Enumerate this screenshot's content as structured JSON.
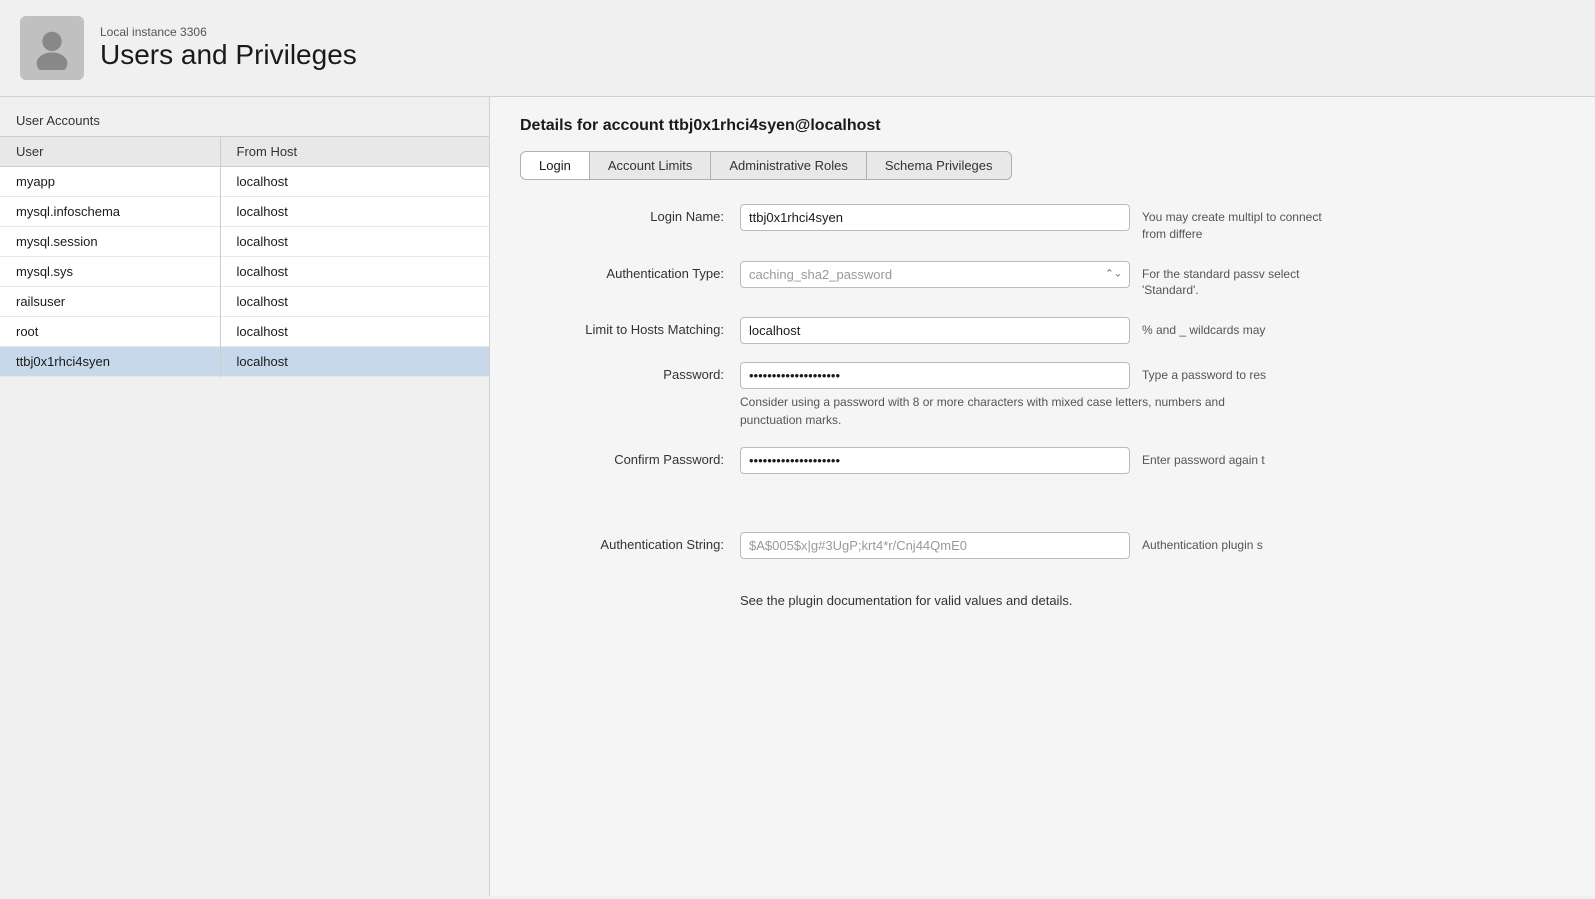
{
  "header": {
    "instance_label": "Local instance 3306",
    "page_title": "Users and Privileges"
  },
  "left_panel": {
    "section_label": "User Accounts",
    "table": {
      "columns": [
        "User",
        "From Host"
      ],
      "rows": [
        {
          "user": "myapp",
          "host": "localhost",
          "selected": false
        },
        {
          "user": "mysql.infoschema",
          "host": "localhost",
          "selected": false
        },
        {
          "user": "mysql.session",
          "host": "localhost",
          "selected": false
        },
        {
          "user": "mysql.sys",
          "host": "localhost",
          "selected": false
        },
        {
          "user": "railsuser",
          "host": "localhost",
          "selected": false
        },
        {
          "user": "root",
          "host": "localhost",
          "selected": false
        },
        {
          "user": "ttbj0x1rhci4syen",
          "host": "localhost",
          "selected": true
        }
      ]
    }
  },
  "right_panel": {
    "details_title": "Details for account ttbj0x1rhci4syen@localhost",
    "tabs": [
      {
        "label": "Login",
        "active": true
      },
      {
        "label": "Account Limits",
        "active": false
      },
      {
        "label": "Administrative Roles",
        "active": false
      },
      {
        "label": "Schema Privileges",
        "active": false
      }
    ],
    "form": {
      "login_name_label": "Login Name:",
      "login_name_value": "ttbj0x1rhci4syen",
      "login_name_hint": "You may create multipl to connect from differe",
      "auth_type_label": "Authentication Type:",
      "auth_type_value": "caching_sha2_password",
      "auth_type_hint": "For the standard passv select 'Standard'.",
      "limit_hosts_label": "Limit to Hosts Matching:",
      "limit_hosts_value": "localhost",
      "limit_hosts_hint": "% and _ wildcards may",
      "password_label": "Password:",
      "password_value": "••••••••••••••••••••",
      "password_hint": "Type a password to res",
      "password_subhint": "Consider using a password with 8 or more characters with mixed case letters, numbers and punctuation marks.",
      "confirm_password_label": "Confirm Password:",
      "confirm_password_value": "••••••••••••••••••••",
      "confirm_password_hint": "Enter password again t",
      "auth_string_label": "Authentication String:",
      "auth_string_value": "$A$005$x|g#3UgP;krt4*r/Cnj44QmE0",
      "auth_string_hint": "Authentication plugin s",
      "bottom_hint": "See the plugin documentation for valid values and details."
    }
  }
}
